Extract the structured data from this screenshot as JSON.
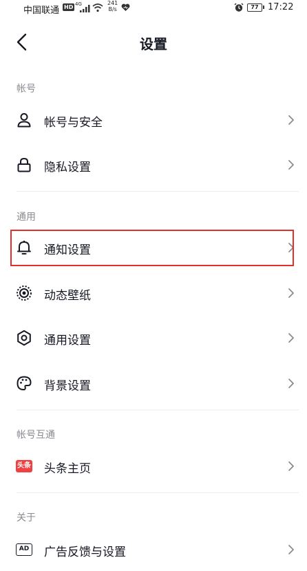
{
  "status_bar": {
    "carrier": "中国联通",
    "hd": "HD",
    "network": "4G",
    "speed_value": "241",
    "speed_unit": "B/s",
    "battery": "77",
    "time": "17:22"
  },
  "nav": {
    "title": "设置"
  },
  "sections": {
    "account": {
      "header": "帐号",
      "items": [
        {
          "label": "帐号与安全",
          "icon": "user-icon"
        },
        {
          "label": "隐私设置",
          "icon": "lock-icon"
        }
      ]
    },
    "general": {
      "header": "通用",
      "items": [
        {
          "label": "通知设置",
          "icon": "bell-icon"
        },
        {
          "label": "动态壁纸",
          "icon": "live-wallpaper-icon"
        },
        {
          "label": "通用设置",
          "icon": "gear-icon"
        },
        {
          "label": "背景设置",
          "icon": "palette-icon"
        }
      ]
    },
    "linked": {
      "header": "帐号互通",
      "items": [
        {
          "label": "头条主页",
          "icon": "toutiao-icon",
          "badge": "头条"
        }
      ]
    },
    "about": {
      "header": "关于",
      "items": [
        {
          "label": "广告反馈与设置",
          "icon": "ad-icon",
          "badge": "AD"
        }
      ]
    }
  },
  "colors": {
    "text_primary": "#161823",
    "text_secondary": "#8a8b91",
    "highlight": "#e0302c",
    "toutiao_red": "#f04142"
  }
}
